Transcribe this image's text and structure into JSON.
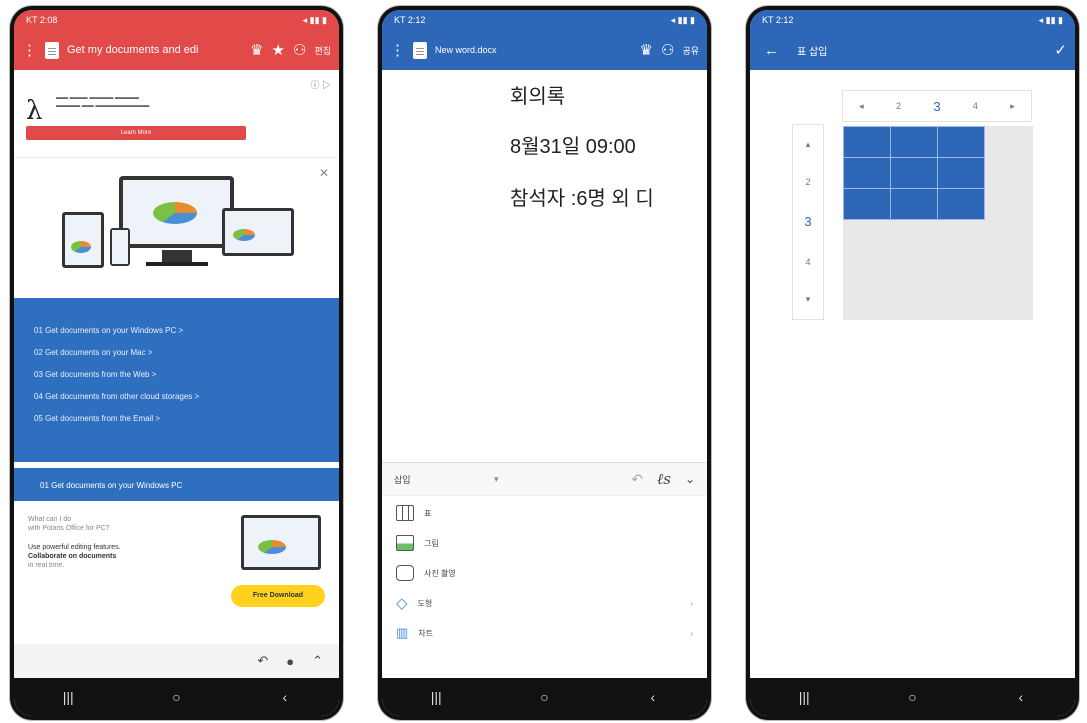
{
  "phone1": {
    "status_left": "KT 2:08",
    "appbar_title": "Get my documents and edi",
    "edit_label": "편집",
    "ad_brand": "λ",
    "ad_button": "Learn More",
    "menu_items": [
      "01  Get documents on your Windows PC  >",
      "02  Get documents on your Mac  >",
      "03  Get documents from the Web  >",
      "04  Get documents from other cloud storages  >",
      "05  Get documents from the Email  >"
    ],
    "section_title": "01  Get documents on your Windows PC",
    "promo_line1": "What can I do",
    "promo_line2": "with Polaris Office for PC?",
    "promo_line3": "Use powerful editing features.",
    "promo_line4": "Collaborate on documents",
    "promo_line5": "in real time.",
    "download_label": "Free Download"
  },
  "phone2": {
    "status_left": "KT 2:12",
    "appbar_title": "New word.docx",
    "share_label": "공유",
    "doc_lines": [
      "회의록",
      "8월31일 09:00",
      "참석자 :6명 외 디"
    ],
    "toolbar_label": "삽입",
    "insert_items": [
      "표",
      "그림",
      "사진 촬영",
      "도형",
      "차트"
    ]
  },
  "phone3": {
    "status_left": "KT 2:12",
    "appbar_title": "표 삽입",
    "col_numbers": [
      "2",
      "3",
      "4"
    ],
    "row_numbers": [
      "2",
      "3",
      "4"
    ]
  },
  "colors": {
    "red": "#e24a4a",
    "blue": "#2f67b8",
    "panel_blue": "#2f6fc0",
    "yellow": "#ffd21f"
  }
}
